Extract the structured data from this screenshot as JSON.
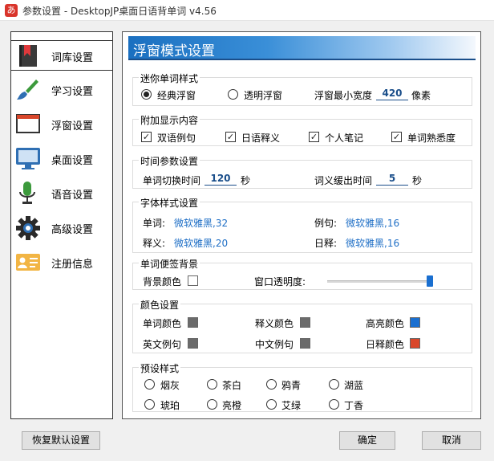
{
  "window": {
    "title": "参数设置 - DesktopJP桌面日语背单词 v4.56",
    "app_icon_glyph": "あ"
  },
  "sidebar": {
    "items": [
      {
        "label": "词库设置",
        "icon": "bookmark-book-icon"
      },
      {
        "label": "学习设置",
        "icon": "paint-brush-icon"
      },
      {
        "label": "浮窗设置",
        "icon": "window-icon"
      },
      {
        "label": "桌面设置",
        "icon": "monitor-icon"
      },
      {
        "label": "语音设置",
        "icon": "microphone-icon"
      },
      {
        "label": "高级设置",
        "icon": "gear-icon"
      },
      {
        "label": "注册信息",
        "icon": "id-card-icon"
      }
    ]
  },
  "panel": {
    "title": "浮窗模式设置",
    "mini_style": {
      "title": "迷你单词样式",
      "option_classic": "经典浮窗",
      "option_transparent": "透明浮窗",
      "selected": "经典浮窗",
      "min_width_label": "浮窗最小宽度",
      "min_width_value": "420",
      "min_width_unit": "像素"
    },
    "extra_content": {
      "title": "附加显示内容",
      "items": [
        {
          "label": "双语例句",
          "checked": true
        },
        {
          "label": "日语释义",
          "checked": true
        },
        {
          "label": "个人笔记",
          "checked": true
        },
        {
          "label": "单词熟悉度",
          "checked": true
        }
      ]
    },
    "time_params": {
      "title": "时间参数设置",
      "switch_label": "单词切换时间",
      "switch_value": "120",
      "switch_unit": "秒",
      "delay_label": "词义缓出时间",
      "delay_value": "5",
      "delay_unit": "秒"
    },
    "font_style": {
      "title": "字体样式设置",
      "word_label": "单词:",
      "word_font": "微软雅黑,32",
      "example_label": "例句:",
      "example_font": "微软雅黑,16",
      "meaning_label": "释义:",
      "meaning_font": "微软雅黑,20",
      "jp_meaning_label": "日释:",
      "jp_meaning_font": "微软雅黑,16"
    },
    "background": {
      "title": "单词便签背景",
      "bg_color_label": "背景颜色",
      "bg_color": "#ffffff",
      "opacity_label": "窗口透明度:",
      "opacity_value": 1.0
    },
    "colors": {
      "title": "颜色设置",
      "items": [
        {
          "label": "单词颜色",
          "color": "#6b6b6b"
        },
        {
          "label": "释义颜色",
          "color": "#6b6b6b"
        },
        {
          "label": "高亮颜色",
          "color": "#1a6fd0"
        },
        {
          "label": "英文例句",
          "color": "#6b6b6b"
        },
        {
          "label": "中文例句",
          "color": "#6b6b6b"
        },
        {
          "label": "日释颜色",
          "color": "#d9472b"
        }
      ]
    },
    "presets": {
      "title": "预设样式",
      "items": [
        "烟灰",
        "茶白",
        "鸦青",
        "湖蓝",
        "琥珀",
        "亮橙",
        "艾绿",
        "丁香"
      ]
    }
  },
  "buttons": {
    "reset": "恢复默认设置",
    "ok": "确定",
    "cancel": "取消"
  }
}
